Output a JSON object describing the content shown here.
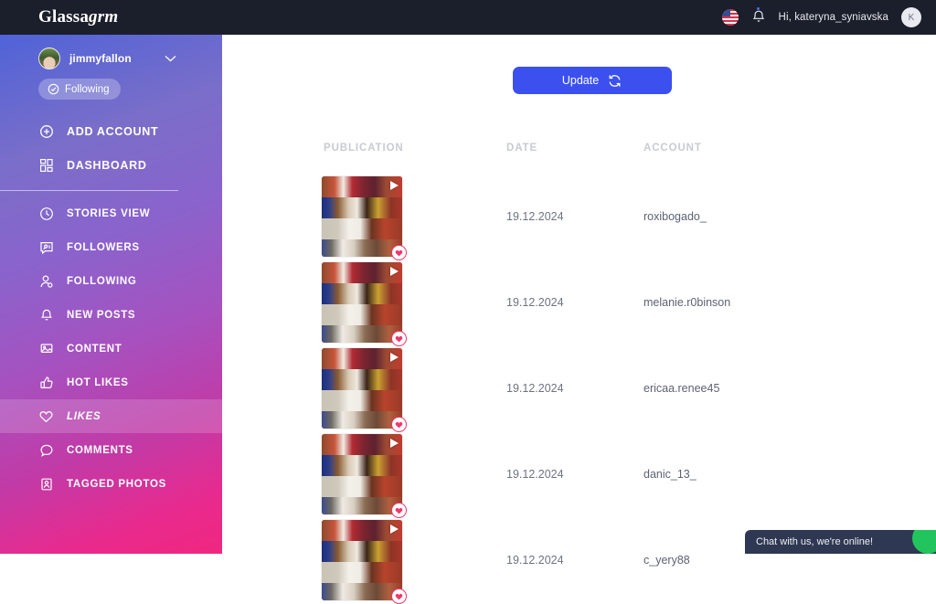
{
  "topbar": {
    "logo_bold": "Glassa",
    "logo_italic": "grm",
    "flag_icon": "us-flag-icon",
    "bell_icon": "bell-icon",
    "greeting": "Hi,  kateryna_syniavska",
    "avatar_initial": "K"
  },
  "sidebar": {
    "account": {
      "name": "jimmyfallon",
      "chevron_icon": "chevron-down-icon",
      "status_label": "Following",
      "status_icon": "check-circle-icon"
    },
    "items": [
      {
        "label": "ADD ACCOUNT",
        "icon": "plus-circle-icon",
        "active": false,
        "strong": true
      },
      {
        "label": "DASHBOARD",
        "icon": "grid-icon",
        "active": false,
        "strong": true
      },
      {
        "label": "STORIES VIEW",
        "icon": "clock-icon",
        "active": false,
        "strong": false
      },
      {
        "label": "FOLLOWERS",
        "icon": "user-message-icon",
        "active": false,
        "strong": false
      },
      {
        "label": "FOLLOWING",
        "icon": "user-add-icon",
        "active": false,
        "strong": false
      },
      {
        "label": "NEW POSTS",
        "icon": "bell-icon",
        "active": false,
        "strong": false
      },
      {
        "label": "CONTENT",
        "icon": "image-icon",
        "active": false,
        "strong": false
      },
      {
        "label": "HOT LIKES",
        "icon": "thumbs-up-icon",
        "active": false,
        "strong": false
      },
      {
        "label": "LIKES",
        "icon": "heart-icon",
        "active": true,
        "strong": false
      },
      {
        "label": "COMMENTS",
        "icon": "comment-icon",
        "active": false,
        "strong": false
      },
      {
        "label": "TAGGED PHOTOS",
        "icon": "tagged-photo-icon",
        "active": false,
        "strong": false
      }
    ],
    "divider_after_index": 1
  },
  "main": {
    "update_button": {
      "label": "Update",
      "icon": "refresh-icon"
    },
    "columns": [
      "PUBLICATION",
      "DATE",
      "ACCOUNT"
    ],
    "rows": [
      {
        "date": "19.12.2024",
        "account": "roxibogado_",
        "media_type": "video",
        "liked": true
      },
      {
        "date": "19.12.2024",
        "account": "melanie.r0binson",
        "media_type": "video",
        "liked": true
      },
      {
        "date": "19.12.2024",
        "account": "ericaa.renee45",
        "media_type": "video",
        "liked": true
      },
      {
        "date": "19.12.2024",
        "account": "danic_13_",
        "media_type": "video",
        "liked": true
      },
      {
        "date": "19.12.2024",
        "account": "c_yery88",
        "media_type": "video",
        "liked": true
      }
    ]
  },
  "chat_widget": {
    "text": "Chat with us, we're online!"
  },
  "colors": {
    "topbar_bg": "#1b1f2b",
    "accent_blue": "#3b50ef",
    "sidebar_from": "#4f63d8",
    "sidebar_to": "#f0277f",
    "heart_pink": "#f2376b",
    "chat_bg": "#2f3852",
    "chat_blob_green": "#22c45e"
  }
}
